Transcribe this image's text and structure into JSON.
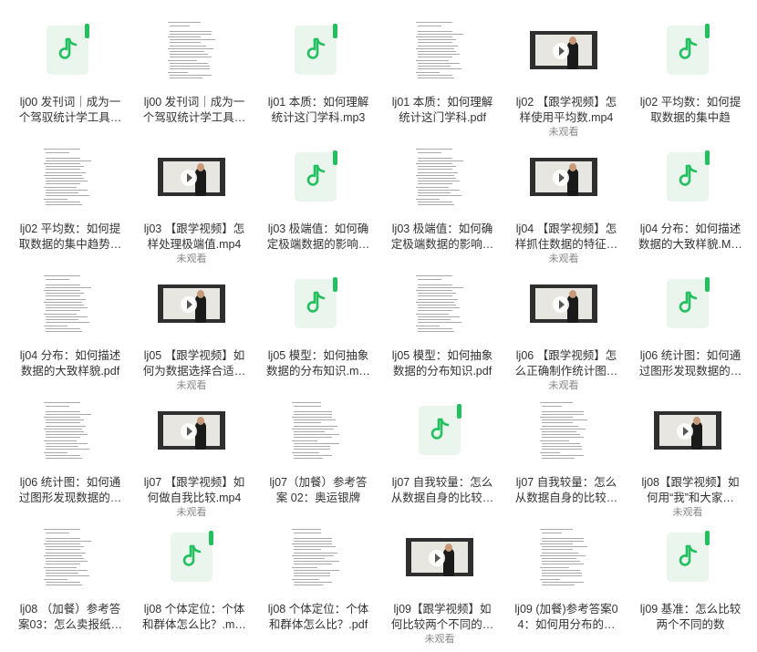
{
  "colors": {
    "accent": "#22c05f",
    "audio_bg": "#eaf5ee",
    "text": "#333333",
    "muted": "#888888"
  },
  "unwatched_label": "未观看",
  "files": [
    {
      "name": "lj00 发刊词｜成为一个驾驭统计学工具…",
      "kind": "audio",
      "icon": "music-note-icon",
      "unwatched": false
    },
    {
      "name": "lj00 发刊词｜成为一个驾驭统计学工具…",
      "kind": "pdf",
      "icon": "pdf-page-thumbnail",
      "unwatched": false
    },
    {
      "name": "lj01 本质：如何理解统计这门学科.mp3",
      "kind": "audio",
      "icon": "music-note-icon",
      "unwatched": false
    },
    {
      "name": "lj01 本质：如何理解统计这门学科.pdf",
      "kind": "pdf",
      "icon": "pdf-page-thumbnail",
      "unwatched": false
    },
    {
      "name": "lj02 【跟学视频】怎样使用平均数.mp4",
      "kind": "video",
      "icon": "video-thumbnail",
      "unwatched": true
    },
    {
      "name": "lj02 平均数：如何提取数据的集中趋势.…",
      "kind": "audio",
      "icon": "music-note-icon",
      "unwatched": false
    },
    {
      "name": "lj02 平均数：如何提取数据的集中趋势…",
      "kind": "pdf",
      "icon": "pdf-page-thumbnail",
      "unwatched": false
    },
    {
      "name": "lj03 【跟学视频】怎样处理极端值.mp4",
      "kind": "video",
      "icon": "video-thumbnail",
      "unwatched": true
    },
    {
      "name": "lj03 极端值：如何确定极端数据的影响…",
      "kind": "audio",
      "icon": "music-note-icon",
      "unwatched": false
    },
    {
      "name": "lj03 极端值：如何确定极端数据的影响…",
      "kind": "pdf",
      "icon": "pdf-page-thumbnail",
      "unwatched": false
    },
    {
      "name": "lj04 【跟学视频】怎样抓住数据的特征…",
      "kind": "video",
      "icon": "video-thumbnail",
      "unwatched": true
    },
    {
      "name": "lj04 分布：如何描述数据的大致样貌.M…",
      "kind": "audio",
      "icon": "music-note-icon",
      "unwatched": false
    },
    {
      "name": "lj04 分布：如何描述数据的大致样貌.pdf",
      "kind": "pdf",
      "icon": "pdf-page-thumbnail",
      "unwatched": false
    },
    {
      "name": "lj05 【跟学视频】如何为数据选择合适…",
      "kind": "video",
      "icon": "video-thumbnail",
      "unwatched": true
    },
    {
      "name": "lj05 模型：如何抽象数据的分布知识.m…",
      "kind": "audio",
      "icon": "music-note-icon",
      "unwatched": false
    },
    {
      "name": "lj05 模型：如何抽象数据的分布知识.pdf",
      "kind": "pdf",
      "icon": "pdf-page-thumbnail",
      "unwatched": false
    },
    {
      "name": "lj06 【跟学视频】怎么正确制作统计图…",
      "kind": "video",
      "icon": "video-thumbnail",
      "unwatched": true
    },
    {
      "name": "lj06 统计图：如何通过图形发现数据的…",
      "kind": "audio",
      "icon": "music-note-icon",
      "unwatched": false
    },
    {
      "name": "lj06 统计图：如何通过图形发现数据的…",
      "kind": "pdf",
      "icon": "pdf-page-thumbnail",
      "unwatched": false
    },
    {
      "name": "lj07 【跟学视频】如何做自我比较.mp4",
      "kind": "video",
      "icon": "video-thumbnail",
      "unwatched": true
    },
    {
      "name": "lj07（加餐）参考答案 02：奥运银牌获…",
      "kind": "pdf",
      "icon": "pdf-page-thumbnail",
      "unwatched": false
    },
    {
      "name": "lj07 自我较量：怎么从数据自身的比较…",
      "kind": "audio",
      "icon": "music-note-icon",
      "unwatched": false
    },
    {
      "name": "lj07 自我较量：怎么从数据自身的比较…",
      "kind": "pdf",
      "icon": "pdf-page-thumbnail",
      "unwatched": false
    },
    {
      "name": "lj08【跟学视频】如何用“我”和大家…",
      "kind": "video",
      "icon": "video-thumbnail",
      "unwatched": true
    },
    {
      "name": "lj08 （加餐）参考答案03：怎么卖报纸…",
      "kind": "pdf",
      "icon": "pdf-page-thumbnail",
      "unwatched": false
    },
    {
      "name": "lj08 个体定位：个体和群体怎么比？.m…",
      "kind": "audio",
      "icon": "music-note-icon",
      "unwatched": false
    },
    {
      "name": "lj08 个体定位：个体和群体怎么比？.pdf",
      "kind": "pdf",
      "icon": "pdf-page-thumbnail",
      "unwatched": false
    },
    {
      "name": "lj09【跟学视频】如何比较两个不同的…",
      "kind": "video",
      "icon": "video-thumbnail",
      "unwatched": true
    },
    {
      "name": "lj09 (加餐)参考答案04：如何用分布的…",
      "kind": "pdf",
      "icon": "pdf-page-thumbnail",
      "unwatched": false
    },
    {
      "name": "lj09 基准：怎么比较两个不同的数据？.…",
      "kind": "audio",
      "icon": "music-note-icon",
      "unwatched": false
    }
  ]
}
